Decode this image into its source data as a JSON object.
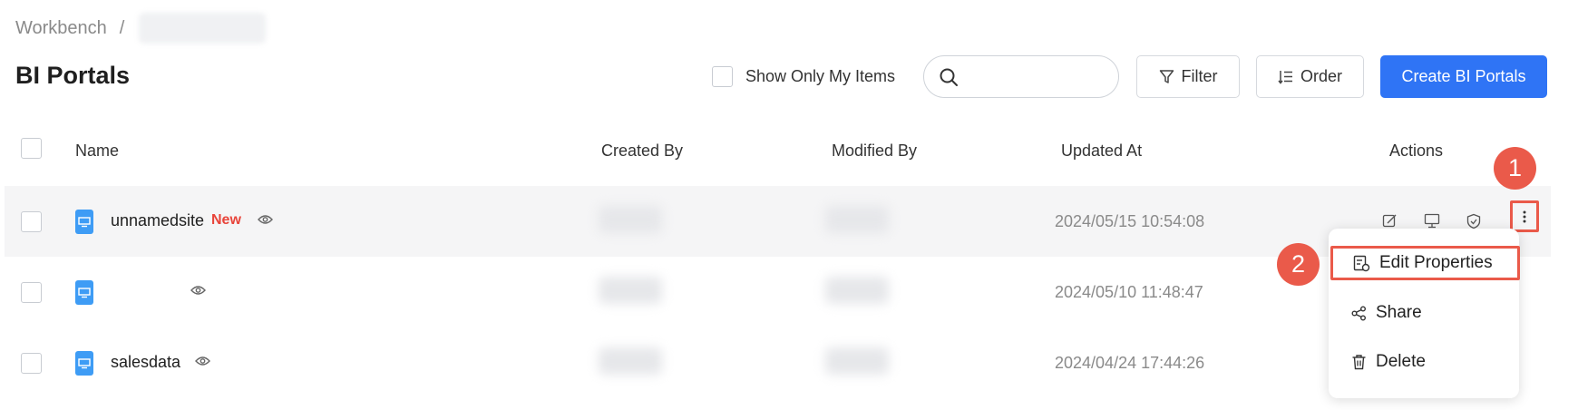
{
  "breadcrumb": {
    "root": "Workbench",
    "separator": "/"
  },
  "page": {
    "title": "BI Portals"
  },
  "toolbar": {
    "only_mine_label": "Show Only My Items",
    "search_placeholder": "",
    "filter_label": "Filter",
    "order_label": "Order",
    "create_label": "Create BI Portals"
  },
  "table": {
    "headers": {
      "name": "Name",
      "created_by": "Created By",
      "modified_by": "Modified By",
      "updated_at": "Updated At",
      "actions": "Actions"
    },
    "rows": [
      {
        "name": "unnamedsite",
        "badge": "New",
        "updated_at": "2024/05/15 10:54:08"
      },
      {
        "name": "",
        "badge": "",
        "updated_at": "2024/05/10 11:48:47"
      },
      {
        "name": "salesdata",
        "badge": "",
        "updated_at": "2024/04/24 17:44:26"
      }
    ]
  },
  "menu": {
    "edit_properties": "Edit Properties",
    "share": "Share",
    "delete": "Delete"
  },
  "callouts": {
    "first": "1",
    "second": "2"
  },
  "colors": {
    "primary": "#2f74f5",
    "callout": "#ea5a4a",
    "new_badge": "#e8443a",
    "site_icon": "#3e9cf5"
  }
}
